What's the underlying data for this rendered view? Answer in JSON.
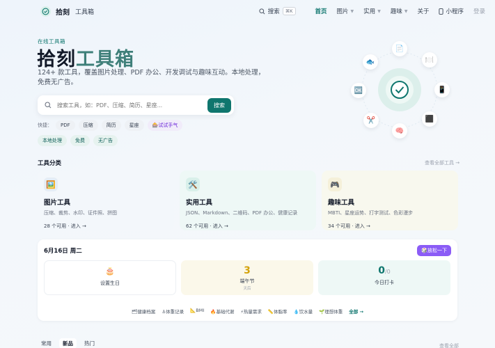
{
  "nav": {
    "brand": "拾刻",
    "brand_sub": "工具箱",
    "search_label": "搜索",
    "search_kbd": "⌘K",
    "links": [
      {
        "label": "首页",
        "active": true,
        "caret": false
      },
      {
        "label": "图片",
        "active": false,
        "caret": true
      },
      {
        "label": "实用",
        "active": false,
        "caret": true
      },
      {
        "label": "趣味",
        "active": false,
        "caret": true
      },
      {
        "label": "关于",
        "active": false,
        "caret": false
      },
      {
        "label": "小程序",
        "active": false,
        "caret": false,
        "icon": "phone-icon"
      }
    ],
    "login": "登录"
  },
  "hero": {
    "tag": "在线工具箱",
    "title_part1": "拾刻",
    "title_part2": "工具箱",
    "description": "124+ 款工具，覆盖图片处理、PDF 办公、开发调试与趣味互动。本地处理，免费无广告。",
    "search_placeholder": "搜索工具，如：PDF、压缩、简历、星座...",
    "search_button": "搜索",
    "quick_label": "快捷：",
    "quick_chips": [
      "PDF",
      "压缩",
      "简历",
      "星座",
      "🎰试试手气"
    ],
    "badges": [
      "本地处理",
      "免费",
      "无广告"
    ]
  },
  "illustration": {
    "orbs": [
      "📄",
      "🐟",
      "🍽️",
      "📱",
      "🆗",
      "✂️",
      "🧠",
      "⬛"
    ]
  },
  "categories": {
    "title": "工具分类",
    "more": "查看全部工具 →",
    "cards": [
      {
        "icon": "🖼️",
        "title": "图片工具",
        "desc": "压缩、裁剪、水印、证件照、拼图",
        "foot": "28 个可用 · 进入 →",
        "bg": "#f3f7fb",
        "icon_bg": "#e5edf5"
      },
      {
        "icon": "🛠️",
        "title": "实用工具",
        "desc": "JSON、Markdown、二维码、PDF 办公、健康记录",
        "foot": "62 个可用 · 进入 →",
        "bg": "#eef8f6",
        "icon_bg": "#d9f0ea"
      },
      {
        "icon": "🎮",
        "title": "趣味工具",
        "desc": "MBTI、星座运势、打字测试、色彩漫步",
        "foot": "34 个可用 · 进入 →",
        "bg": "#f8f8ee",
        "icon_bg": "#f5f0d9"
      }
    ]
  },
  "day_panel": {
    "date": "6月16日 周二",
    "relax_button": "🎲放松一下",
    "tiles": [
      {
        "icon": "🎂",
        "label": "设置生日",
        "bg": "#ffffff",
        "border": "#eceff3"
      },
      {
        "big": "3",
        "label": "端午节",
        "sub": "天后",
        "bg": "#fbf8ea",
        "color": "#d4a30c"
      },
      {
        "big": "0",
        "big_suffix": "/0",
        "label": "今日打卡",
        "bg": "#eef8f6",
        "color": "#0f766e"
      }
    ],
    "links": [
      "🗂健康档案",
      "⚓体重记录",
      "📐BMI",
      "🔥基础代谢",
      "⚡热量需求",
      "📏体脂率",
      "💧饮水量",
      "🌱理想体重"
    ],
    "all_link": "全部 →"
  },
  "bottom": {
    "tabs": [
      {
        "label": "常用",
        "active": false
      },
      {
        "label": "新品",
        "active": true
      },
      {
        "label": "热门",
        "active": false
      }
    ],
    "more": "查看全部"
  },
  "colors": {
    "accent": "#0f766e",
    "purple": "#8b5cf6"
  }
}
